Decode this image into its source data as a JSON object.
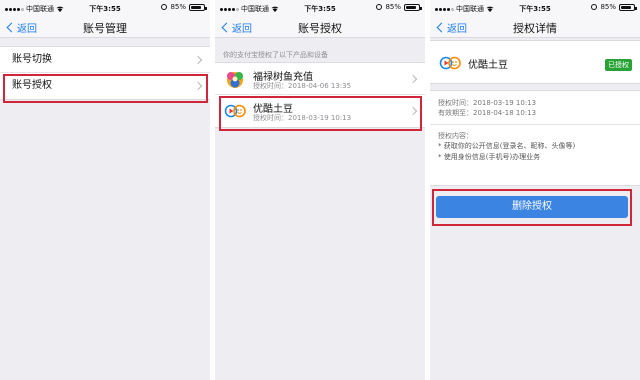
{
  "status": {
    "carrier": "中国联通",
    "time": "下午3:55",
    "battery": "85%",
    "battery_level": 0.85
  },
  "screen1": {
    "back": "返回",
    "title": "账号管理",
    "items": [
      {
        "label": "账号切换"
      },
      {
        "label": "账号授权"
      }
    ]
  },
  "screen2": {
    "back": "返回",
    "title": "账号授权",
    "note": "你的支付宝授权了以下产品和设备",
    "apps": [
      {
        "name": "福禄树鱼充值",
        "time": "授权时间：2018-04-06 13:35",
        "icon": "fulu-app-icon"
      },
      {
        "name": "优酷土豆",
        "time": "授权时间：2018-03-19 10:13",
        "icon": "youku-tudou-icon"
      }
    ]
  },
  "screen3": {
    "back": "返回",
    "title": "授权详情",
    "app_name": "优酷土豆",
    "badge": "已授权",
    "auth_time": "授权时间：2018-03-19 10:13",
    "valid_until": "有效期至：2018-04-18 10:13",
    "content_title": "授权内容：",
    "bullets": [
      "* 获取你的公开信息(登录名、昵称、头像等)",
      "* 使用身份信息(手机号)办理业务"
    ],
    "delete_button": "删除授权"
  },
  "colors": {
    "accent": "#1a7cf3",
    "highlight": "#d0263a",
    "button": "#3b84e2",
    "badge": "#27a336"
  }
}
